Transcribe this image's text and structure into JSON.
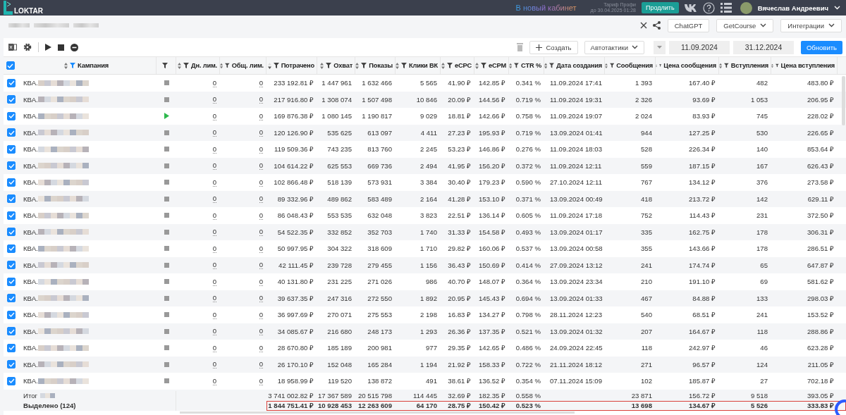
{
  "topbar": {
    "logo": "LOKTAR",
    "new_cabinet_link": "В новый кабинет",
    "tariff": "Тариф Профи",
    "tariff_until": "до 30.04.2025 01:28",
    "renew_button": "Продлить",
    "user_name": "Вячеслав Андреевич"
  },
  "subbar": {
    "buttons": [
      {
        "label": "ChatGPT",
        "kind": "plain"
      },
      {
        "label": "GetCourse",
        "kind": "dropdown"
      },
      {
        "label": "Интеграции",
        "kind": "dropdown"
      }
    ]
  },
  "toolbar": {
    "create_button": "Создать",
    "autotactics_button": "Автотактики",
    "date_from": "11.09.2024",
    "date_to": "31.12.2024",
    "refresh_button": "Обновить"
  },
  "table": {
    "all_selected": true,
    "campaign_header": {
      "label": "Кампания",
      "sorted": false,
      "filter_active": true
    },
    "status_header": {
      "filter_active": false
    },
    "columns": [
      {
        "kind": "limit",
        "label": "Дн. лим.",
        "sorted": false,
        "filter_active": false
      },
      {
        "kind": "limit",
        "label": "Общ. лим.",
        "sorted": false,
        "filter_active": false
      },
      {
        "kind": "number",
        "label": "Потрачено",
        "sorted": true,
        "filter_active": false
      },
      {
        "kind": "number",
        "label": "Охват",
        "sorted": false,
        "filter_active": false
      },
      {
        "kind": "number",
        "label": "Показы",
        "sorted": false,
        "filter_active": false
      },
      {
        "kind": "number",
        "label": "Клики ВК",
        "sorted": false,
        "filter_active": false
      },
      {
        "kind": "number",
        "label": "eCPC",
        "sorted": false,
        "filter_active": false
      },
      {
        "kind": "number",
        "label": "eCPM",
        "sorted": false,
        "filter_active": false
      },
      {
        "kind": "number",
        "label": "CTR %",
        "sorted": false,
        "filter_active": false
      },
      {
        "kind": "date",
        "label": "Дата создания",
        "sorted": false,
        "filter_active": false
      },
      {
        "kind": "number",
        "label": "Сообщения",
        "sorted": false,
        "filter_active": false
      },
      {
        "kind": "number",
        "label": "Цена сообщения",
        "sorted": false,
        "filter_active": false
      },
      {
        "kind": "number",
        "label": "Вступления",
        "sorted": false,
        "filter_active": false
      },
      {
        "kind": "number",
        "label": "Цена вступления",
        "sorted": false,
        "filter_active": false
      }
    ],
    "rows": [
      {
        "selected": true,
        "name": "КВА.",
        "running": false,
        "cells": [
          "0",
          "0",
          "233 192.81 ₽",
          "1 447 961",
          "1 632 466",
          "5 565",
          "41.90 ₽",
          "142.85 ₽",
          "0.341 %",
          "11.09.2024 17:41",
          "1 393",
          "167.40 ₽",
          "482",
          "483.80 ₽"
        ]
      },
      {
        "selected": true,
        "name": "КВА.",
        "running": false,
        "cells": [
          "0",
          "0",
          "217 916.80 ₽",
          "1 308 074",
          "1 507 498",
          "10 846",
          "20.09 ₽",
          "144.56 ₽",
          "0.719 %",
          "11.09.2024 19:31",
          "2 326",
          "93.69 ₽",
          "1 053",
          "206.95 ₽"
        ]
      },
      {
        "selected": true,
        "name": "КВА.",
        "running": true,
        "cells": [
          "0",
          "0",
          "169 876.38 ₽",
          "1 080 145",
          "1 190 817",
          "9 029",
          "18.81 ₽",
          "142.66 ₽",
          "0.758 %",
          "11.09.2024 19:07",
          "2 024",
          "83.93 ₽",
          "745",
          "228.02 ₽"
        ]
      },
      {
        "selected": true,
        "name": "КВА.",
        "running": false,
        "cells": [
          "0",
          "0",
          "120 126.90 ₽",
          "535 625",
          "613 097",
          "4 411",
          "27.23 ₽",
          "195.93 ₽",
          "0.719 %",
          "13.09.2024 01:41",
          "944",
          "127.25 ₽",
          "530",
          "226.65 ₽"
        ]
      },
      {
        "selected": true,
        "name": "КВА.",
        "running": false,
        "cells": [
          "0",
          "0",
          "119 509.36 ₽",
          "743 235",
          "813 760",
          "2 245",
          "53.23 ₽",
          "146.86 ₽",
          "0.276 %",
          "11.09.2024 18:03",
          "528",
          "226.34 ₽",
          "140",
          "853.64 ₽"
        ]
      },
      {
        "selected": true,
        "name": "КВА.",
        "running": false,
        "cells": [
          "0",
          "0",
          "104 614.22 ₽",
          "625 553",
          "669 736",
          "2 494",
          "41.95 ₽",
          "156.20 ₽",
          "0.372 %",
          "11.09.2024 12:11",
          "559",
          "187.15 ₽",
          "167",
          "626.43 ₽"
        ]
      },
      {
        "selected": true,
        "name": "КВА.",
        "running": false,
        "cells": [
          "0",
          "0",
          "102 866.48 ₽",
          "518 139",
          "573 931",
          "3 384",
          "30.40 ₽",
          "179.23 ₽",
          "0.590 %",
          "27.10.2024 12:11",
          "767",
          "134.12 ₽",
          "376",
          "273.58 ₽"
        ]
      },
      {
        "selected": true,
        "name": "КВА.",
        "running": false,
        "cells": [
          "0",
          "0",
          "89 332.96 ₽",
          "489 862",
          "583 489",
          "2 164",
          "41.28 ₽",
          "153.10 ₽",
          "0.371 %",
          "13.09.2024 00:49",
          "418",
          "213.72 ₽",
          "142",
          "629.11 ₽"
        ]
      },
      {
        "selected": true,
        "name": "КВА.",
        "running": false,
        "cells": [
          "0",
          "0",
          "86 048.43 ₽",
          "553 535",
          "632 048",
          "3 823",
          "22.51 ₽",
          "136.14 ₽",
          "0.605 %",
          "11.09.2024 17:18",
          "752",
          "114.43 ₽",
          "231",
          "372.50 ₽"
        ]
      },
      {
        "selected": true,
        "name": "КВА.",
        "running": false,
        "cells": [
          "0",
          "0",
          "54 522.35 ₽",
          "332 852",
          "352 703",
          "1 740",
          "31.33 ₽",
          "154.58 ₽",
          "0.493 %",
          "13.09.2024 01:17",
          "335",
          "162.75 ₽",
          "178",
          "306.31 ₽"
        ]
      },
      {
        "selected": true,
        "name": "КВА.",
        "running": false,
        "cells": [
          "0",
          "0",
          "50 997.95 ₽",
          "304 322",
          "318 609",
          "1 710",
          "29.82 ₽",
          "160.06 ₽",
          "0.537 %",
          "13.09.2024 00:58",
          "355",
          "143.66 ₽",
          "178",
          "286.51 ₽"
        ]
      },
      {
        "selected": true,
        "name": "КВА.",
        "running": false,
        "cells": [
          "0",
          "0",
          "42 111.45 ₽",
          "239 728",
          "279 455",
          "1 156",
          "36.43 ₽",
          "150.69 ₽",
          "0.414 %",
          "27.09.2024 13:12",
          "241",
          "174.74 ₽",
          "65",
          "647.87 ₽"
        ]
      },
      {
        "selected": true,
        "name": "КВА.",
        "running": false,
        "cells": [
          "0",
          "0",
          "40 131.80 ₽",
          "231 225",
          "271 026",
          "986",
          "40.70 ₽",
          "148.07 ₽",
          "0.364 %",
          "13.09.2024 23:34",
          "210",
          "191.10 ₽",
          "69",
          "581.62 ₽"
        ]
      },
      {
        "selected": true,
        "name": "КВА.",
        "running": false,
        "cells": [
          "0",
          "0",
          "39 637.35 ₽",
          "247 316",
          "272 550",
          "1 892",
          "20.95 ₽",
          "145.43 ₽",
          "0.694 %",
          "13.09.2024 01:33",
          "467",
          "84.88 ₽",
          "133",
          "298.03 ₽"
        ]
      },
      {
        "selected": true,
        "name": "КВА.",
        "running": false,
        "cells": [
          "0",
          "0",
          "36 997.69 ₽",
          "270 071",
          "275 553",
          "2 198",
          "16.83 ₽",
          "134.27 ₽",
          "0.798 %",
          "28.11.2024 12:23",
          "540",
          "68.51 ₽",
          "241",
          "153.52 ₽"
        ]
      },
      {
        "selected": true,
        "name": "КВА.",
        "running": false,
        "cells": [
          "0",
          "0",
          "34 085.67 ₽",
          "216 680",
          "248 173",
          "1 293",
          "26.36 ₽",
          "137.35 ₽",
          "0.521 %",
          "13.09.2024 01:32",
          "207",
          "164.67 ₽",
          "118",
          "288.86 ₽"
        ]
      },
      {
        "selected": true,
        "name": "КВА.",
        "running": false,
        "cells": [
          "0",
          "0",
          "28 670.80 ₽",
          "185 189",
          "200 981",
          "977",
          "29.35 ₽",
          "142.65 ₽",
          "0.486 %",
          "24.09.2024 22:45",
          "118",
          "242.97 ₽",
          "46",
          "623.28 ₽"
        ]
      },
      {
        "selected": true,
        "name": "КВА.",
        "running": false,
        "cells": [
          "0",
          "0",
          "26 170.10 ₽",
          "152 048",
          "165 284",
          "1 194",
          "21.92 ₽",
          "158.33 ₽",
          "0.722 %",
          "21.11.2024 18:12",
          "271",
          "96.57 ₽",
          "124",
          "211.05 ₽"
        ]
      },
      {
        "selected": true,
        "name": "КВА.",
        "running": false,
        "cells": [
          "0",
          "0",
          "18 958.99 ₽",
          "119 520",
          "138 872",
          "491",
          "38.61 ₽",
          "136.52 ₽",
          "0.354 %",
          "07.11.2024 15:09",
          "102",
          "185.87 ₽",
          "27",
          "702.18 ₽"
        ]
      }
    ],
    "footer": [
      {
        "kind": "total",
        "label": "Итог",
        "values": [
          "3 741 002.82 ₽",
          "17 367 589",
          "20 515 798",
          "114 445",
          "32.69 ₽",
          "182.35 ₽",
          "0.558 %",
          "23 871",
          "156.72 ₽",
          "9 518",
          "393.05 ₽"
        ]
      },
      {
        "kind": "selected",
        "label": "Выделено (124)",
        "outlined": true,
        "values": [
          "1 844 751.41 ₽",
          "10 928 453",
          "12 263 609",
          "64 170",
          "28.75 ₽",
          "150.42 ₽",
          "0.523 %",
          "13 698",
          "134.67 ₽",
          "5 526",
          "333.83 ₽"
        ]
      }
    ]
  }
}
